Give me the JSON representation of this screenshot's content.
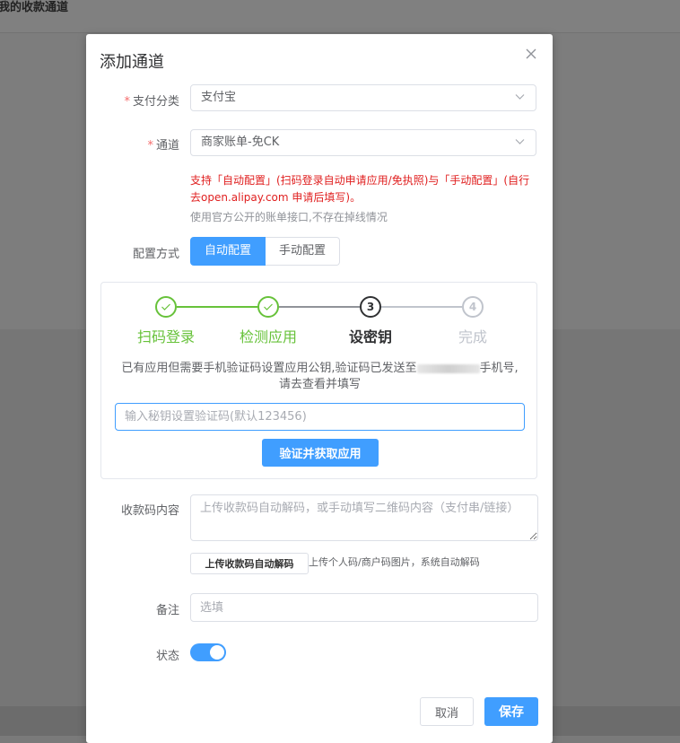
{
  "background": {
    "page_title": "我的收款通道"
  },
  "dialog": {
    "title": "添加通道",
    "fields": {
      "payment_category": {
        "label": "支付分类",
        "value": "支付宝"
      },
      "channel": {
        "label": "通道",
        "value": "商家账单-免CK"
      },
      "hint_red": "支持「自动配置」(扫码登录自动申请应用/免执照)与「手动配置」(自行去open.alipay.com 申请后填写)。",
      "hint_gray": "使用官方公开的账单接口,不存在掉线情况",
      "config_mode": {
        "label": "配置方式",
        "options": [
          "自动配置",
          "手动配置"
        ],
        "selected": "自动配置"
      }
    },
    "steps": {
      "items": [
        {
          "label": "扫码登录",
          "status": "done"
        },
        {
          "label": "检测应用",
          "status": "done"
        },
        {
          "label": "设密钥",
          "number": "3",
          "status": "active"
        },
        {
          "label": "完成",
          "number": "4",
          "status": "pending"
        }
      ],
      "verify_text_before": "已有应用但需要手机验证码设置应用公钥,验证码已发送至",
      "verify_text_after": "手机号,请去查看并填写",
      "code_placeholder": "输入秘钥设置验证码(默认123456)",
      "verify_button": "验证并获取应用"
    },
    "qr_content": {
      "label": "收款码内容",
      "placeholder": "上传收款码自动解码，或手动填写二维码内容（支付串/链接）",
      "upload_button": "上传收款码自动解码",
      "upload_hint": "上传个人码/商户码图片，系统自动解码"
    },
    "remark": {
      "label": "备注",
      "placeholder": "选填"
    },
    "status": {
      "label": "状态",
      "enabled": true
    },
    "footer": {
      "cancel": "取消",
      "save": "保存"
    }
  },
  "colors": {
    "primary": "#409eff",
    "success": "#67c23a",
    "danger": "#e02020",
    "pending": "#c0c4cc"
  }
}
